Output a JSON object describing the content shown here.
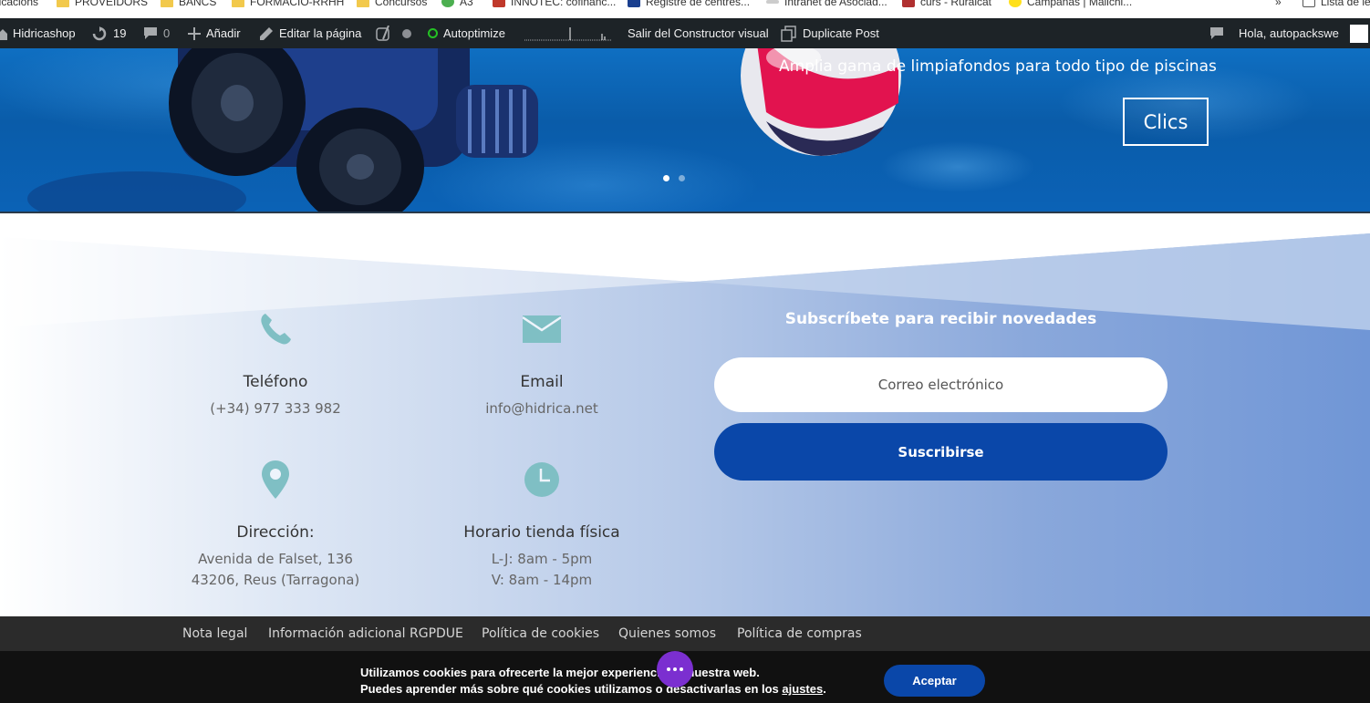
{
  "bookmarks": [
    {
      "label": "licacions",
      "icon": "none"
    },
    {
      "label": "PROVEIDORS",
      "icon": "folder-icon"
    },
    {
      "label": "BANCS",
      "icon": "folder-icon"
    },
    {
      "label": "FORMACIO-RRHH",
      "icon": "folder-icon"
    },
    {
      "label": "Concursos",
      "icon": "folder-icon"
    },
    {
      "label": "A3",
      "icon": "app-icon"
    },
    {
      "label": "INNOTEC: cofinanc...",
      "icon": "cat-icon"
    },
    {
      "label": "Registre de centres...",
      "icon": "soc-icon"
    },
    {
      "label": "Intranet de Asociad...",
      "icon": "page-icon"
    },
    {
      "label": "curs - Ruralcat",
      "icon": "grid-icon"
    },
    {
      "label": "Campañas | Mailchi...",
      "icon": "mailchimp-icon"
    },
    {
      "label": "»",
      "icon": "none"
    },
    {
      "label": "Lista de le",
      "icon": "list-icon"
    }
  ],
  "adminbar": {
    "site": "Hidricashop",
    "updates": "19",
    "comments": "0",
    "add": "Añadir",
    "edit": "Editar la página",
    "autoptimize": "Autoptimize",
    "exit_builder": "Salir del Constructor visual",
    "duplicate": "Duplicate Post",
    "greeting": "Hola, autopackswe"
  },
  "hero": {
    "subtitle": "Amplia gama de limpiafondos para todo tipo de piscinas",
    "button": "Clics",
    "slides": 2,
    "active_slide": 1
  },
  "contact": {
    "phone": {
      "label": "Teléfono",
      "value": "(+34) 977 333 982",
      "icon": "phone-icon"
    },
    "email": {
      "label": "Email",
      "value": "info@hidrica.net",
      "icon": "envelope-icon"
    },
    "address": {
      "label": "Dirección:",
      "line1": "Avenida de Falset, 136",
      "line2": "43206, Reus (Tarragona)",
      "icon": "map-pin-icon"
    },
    "hours": {
      "label": "Horario tienda física",
      "line1": "L-J: 8am - 5pm",
      "line2": "V: 8am - 14pm",
      "icon": "clock-icon"
    }
  },
  "subscribe": {
    "title": "Subscríbete para recibir novedades",
    "placeholder": "Correo electrónico",
    "button": "Suscribirse"
  },
  "footer_nav": [
    "Nota legal",
    "Información adicional RGPDUE",
    "Política de cookies",
    "Quienes somos",
    "Política de compras"
  ],
  "cookie": {
    "line1": "Utilizamos cookies para ofrecerte la mejor experiencia en nuestra web.",
    "line2_pre": "Puedes aprender más sobre qué cookies utilizamos o desactivarlas en los ",
    "line2_link": "ajustes",
    "line2_post": ".",
    "accept": "Aceptar"
  },
  "colors": {
    "adminbar": "#1d2327",
    "accent_blue": "#0a47a9",
    "icon_teal": "#7fbfc4",
    "footer_nav": "#2b2b2b",
    "cookie_bg": "#111111",
    "chat_purple": "#7b2fd0"
  }
}
